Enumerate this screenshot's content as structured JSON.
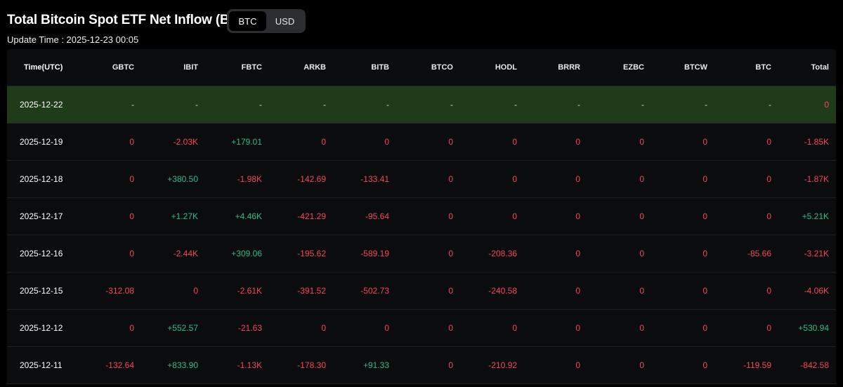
{
  "page": {
    "title": "Total Bitcoin Spot ETF Net Inflow (BTC)",
    "update_time": "Update Time : 2025-12-23 00:05"
  },
  "toggle": {
    "options": [
      "BTC",
      "USD"
    ],
    "selected": "BTC"
  },
  "colors": {
    "positive": "#2ebd85",
    "negative": "#f6465d",
    "highlight_row": "#1f3b19",
    "background": "#000000"
  },
  "table": {
    "columns": [
      "Time(UTC)",
      "GBTC",
      "IBIT",
      "FBTC",
      "ARKB",
      "BITB",
      "BTCO",
      "HODL",
      "BRRR",
      "EZBC",
      "BTCW",
      "BTC",
      "Total"
    ],
    "rows": [
      [
        "2025-12-22",
        "-",
        "-",
        "-",
        "-",
        "-",
        "-",
        "-",
        "-",
        "-",
        "-",
        "-",
        "0"
      ],
      [
        "2025-12-19",
        "0",
        "-2.03K",
        "+179.01",
        "0",
        "0",
        "0",
        "0",
        "0",
        "0",
        "0",
        "0",
        "-1.85K"
      ],
      [
        "2025-12-18",
        "0",
        "+380.50",
        "-1.98K",
        "-142.69",
        "-133.41",
        "0",
        "0",
        "0",
        "0",
        "0",
        "0",
        "-1.87K"
      ],
      [
        "2025-12-17",
        "0",
        "+1.27K",
        "+4.46K",
        "-421.29",
        "-95.64",
        "0",
        "0",
        "0",
        "0",
        "0",
        "0",
        "+5.21K"
      ],
      [
        "2025-12-16",
        "0",
        "-2.44K",
        "+309.06",
        "-195.62",
        "-589.19",
        "0",
        "-208.36",
        "0",
        "0",
        "0",
        "-85.66",
        "-3.21K"
      ],
      [
        "2025-12-15",
        "-312.08",
        "0",
        "-2.61K",
        "-391.52",
        "-502.73",
        "0",
        "-240.58",
        "0",
        "0",
        "0",
        "0",
        "-4.06K"
      ],
      [
        "2025-12-12",
        "0",
        "+552.57",
        "-21.63",
        "0",
        "0",
        "0",
        "0",
        "0",
        "0",
        "0",
        "0",
        "+530.94"
      ],
      [
        "2025-12-11",
        "-132.64",
        "+833.90",
        "-1.13K",
        "-178.30",
        "+91.33",
        "0",
        "-210.92",
        "0",
        "0",
        "0",
        "-119.59",
        "-842.58"
      ]
    ]
  }
}
